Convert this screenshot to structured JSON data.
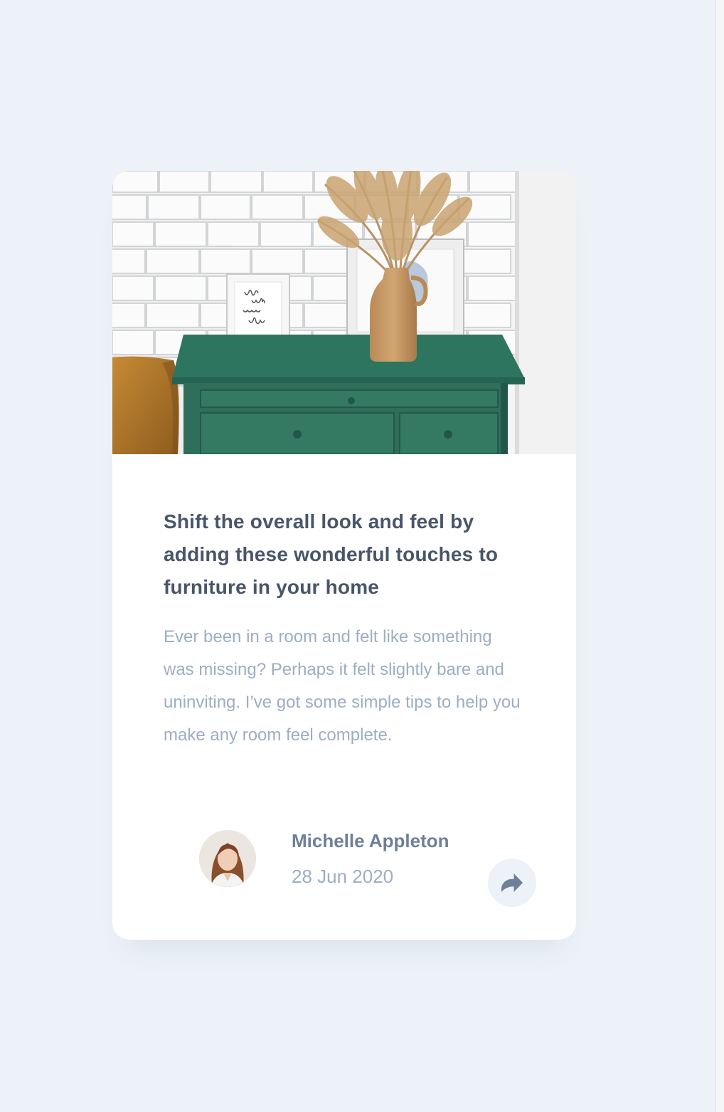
{
  "article": {
    "title": "Shift the overall look and feel by adding these wonderful touches to furniture in your home",
    "description": "Ever been in a room and felt like something was missing? Perhaps it felt slightly bare and uninviting. I’ve got some simple tips to help you make any room feel complete.",
    "image_alt": "drawers-photo"
  },
  "author": {
    "name": "Michelle Appleton",
    "date": "28 Jun 2020"
  },
  "icons": {
    "share": "share-icon"
  },
  "colors": {
    "page_background": "#ecf2f8",
    "title": "#48556a",
    "body_text": "#9daec2",
    "author_name": "#6e8098",
    "share_icon": "#6e8098",
    "share_button_bg": "#ecf2f8"
  }
}
